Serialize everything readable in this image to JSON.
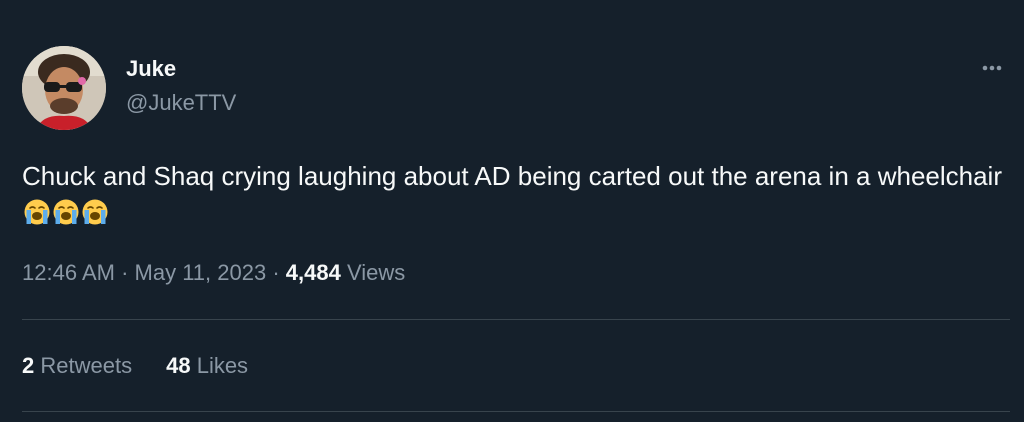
{
  "author": {
    "name": "Juke",
    "handle": "@JukeTTV"
  },
  "tweet": {
    "text": "Chuck and Shaq crying laughing about AD being carted out the arena in a wheelchair",
    "emojis": [
      "loudly-crying-face-emoji",
      "loudly-crying-face-emoji",
      "loudly-crying-face-emoji"
    ],
    "time": "12:46 AM",
    "separator": "·",
    "date": "May 11, 2023",
    "views_count": "4,484",
    "views_label": "Views"
  },
  "engagement": {
    "retweets_count": "2",
    "retweets_label": "Retweets",
    "likes_count": "48",
    "likes_label": "Likes"
  },
  "icons": {
    "more": "more-options-icon"
  },
  "colors": {
    "background": "#15202b",
    "primary_text": "#f7f9f9",
    "secondary_text": "#8b98a5",
    "divider": "#38444d"
  }
}
